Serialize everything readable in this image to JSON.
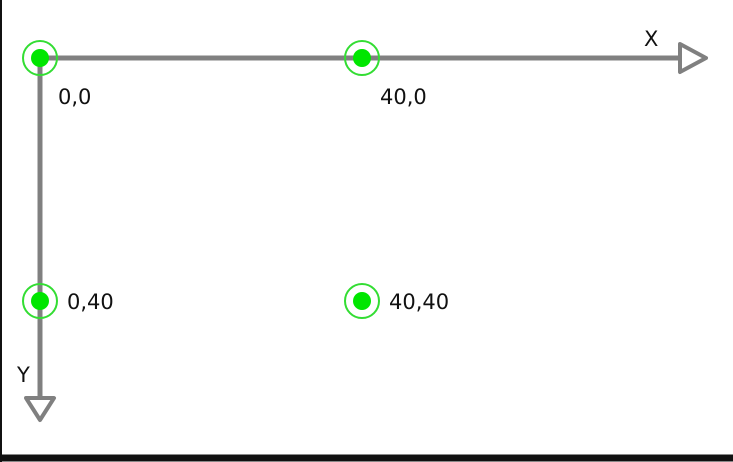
{
  "axes": {
    "x_label": "X",
    "y_label": "Y",
    "color": "#808080"
  },
  "points": [
    {
      "label": "0,0",
      "x": 0,
      "y": 0
    },
    {
      "label": "40,0",
      "x": 40,
      "y": 0
    },
    {
      "label": "0,40",
      "x": 0,
      "y": 40
    },
    {
      "label": "40,40",
      "x": 40,
      "y": 40
    }
  ],
  "colors": {
    "point_fill": "#00e600",
    "point_ring": "#33dd33",
    "frame": "#111111",
    "background": "#ffffff"
  }
}
